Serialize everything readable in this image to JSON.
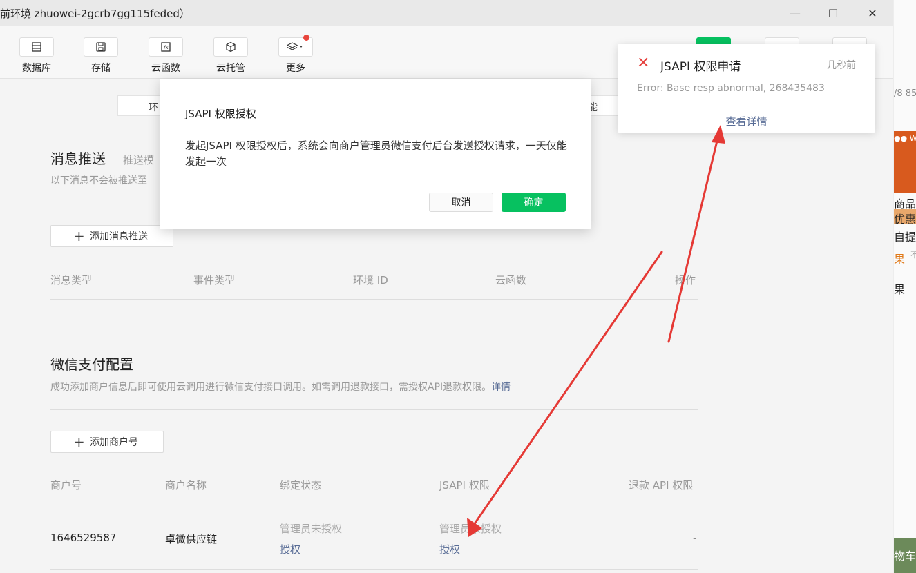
{
  "window": {
    "title": "前环境 zhuowei-2gcrb7gg115feded）",
    "minimize": "—",
    "maximize": "☐",
    "close": "✕"
  },
  "toolbar": {
    "items": [
      {
        "label": "数据库",
        "icon": "database-icon"
      },
      {
        "label": "存储",
        "icon": "save-icon"
      },
      {
        "label": "云函数",
        "icon": "function-icon"
      },
      {
        "label": "云托管",
        "icon": "cube-icon"
      },
      {
        "label": "更多",
        "icon": "layers-icon"
      }
    ]
  },
  "tabs": {
    "left_partial": "环",
    "right_partial": "能"
  },
  "message_push": {
    "title": "消息推送",
    "subtitle": "推送模",
    "desc": "以下消息不会被推送至",
    "add_button": "添加消息推送",
    "columns": [
      "消息类型",
      "事件类型",
      "环境 ID",
      "云函数",
      "操作"
    ]
  },
  "wechat_pay": {
    "title": "微信支付配置",
    "desc": "成功添加商户信息后即可使用云调用进行微信支付接口调用。如需调用退款接口，需授权API退款权限。",
    "desc_link": "详情",
    "add_button": "添加商户号",
    "columns": [
      "商户号",
      "商户名称",
      "绑定状态",
      "JSAPI 权限",
      "退款 API 权限"
    ],
    "rows": [
      {
        "merchant_id": "1646529587",
        "merchant_name": "卓微供应链",
        "bind_status": "管理员未授权",
        "bind_action": "授权",
        "jsapi_status": "管理员未授权",
        "jsapi_action": "授权",
        "refund": "-"
      }
    ]
  },
  "modal": {
    "title": "JSAPI 权限授权",
    "body": "发起JSAPI 权限授权后，系统会向商户管理员微信支付后台发送授权请求，一天仅能发起一次",
    "cancel": "取消",
    "confirm": "确定"
  },
  "notification": {
    "title": "JSAPI 权限申请",
    "time": "几秒前",
    "error": "Error: Base resp abnormal, 268435483",
    "detail_link": "查看详情"
  },
  "right_background": {
    "texts": [
      "/8 85",
      "●● We",
      "商品",
      "优惠",
      "自提",
      "果",
      "不",
      "果",
      "物车"
    ]
  },
  "colors": {
    "accent_green": "#07c160",
    "link_blue": "#576b95",
    "error_red": "#e64340",
    "arrow_red": "#e53935"
  }
}
